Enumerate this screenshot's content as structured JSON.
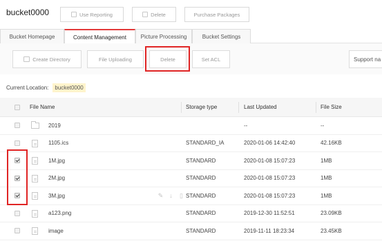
{
  "header": {
    "bucket_name": "bucket0000",
    "buttons": {
      "use_reporting": "Use Reporting",
      "delete": "Delete",
      "purchase_packages": "Purchase Packages"
    }
  },
  "tabs": {
    "bucket_homepage": "Bucket Homepage",
    "content_management": "Content Management",
    "picture_processing": "Picture Processing",
    "bucket_settings": "Bucket Settings",
    "active": "Content Management"
  },
  "toolbar": {
    "create_directory": "Create Directory",
    "file_uploading": "File Uploading",
    "delete": "Delete",
    "set_acl": "Set ACL",
    "search_placeholder": "Support na"
  },
  "location": {
    "label": "Current Location:",
    "value": "bucket0000"
  },
  "table": {
    "columns": {
      "file_name": "File Name",
      "storage_type": "Storage type",
      "last_updated": "Last Updated",
      "file_size": "File Size"
    },
    "rows": [
      {
        "name": "2019",
        "type": "folder",
        "storage": "",
        "updated": "--",
        "size": "--",
        "checked": false
      },
      {
        "name": "1105.ics",
        "type": "file",
        "storage": "STANDARD_IA",
        "updated": "2020-01-06 14:42:40",
        "size": "42.16KB",
        "checked": false
      },
      {
        "name": "1M.jpg",
        "type": "file",
        "storage": "STANDARD",
        "updated": "2020-01-08 15:07:23",
        "size": "1MB",
        "checked": true
      },
      {
        "name": "2M.jpg",
        "type": "file",
        "storage": "STANDARD",
        "updated": "2020-01-08 15:07:23",
        "size": "1MB",
        "checked": true
      },
      {
        "name": "3M.jpg",
        "type": "file",
        "storage": "STANDARD",
        "updated": "2020-01-08 15:07:23",
        "size": "1MB",
        "checked": true
      },
      {
        "name": "a123.png",
        "type": "file",
        "storage": "STANDARD",
        "updated": "2019-12-30 11:52:51",
        "size": "23.09KB",
        "checked": false
      },
      {
        "name": "image",
        "type": "file",
        "storage": "STANDARD",
        "updated": "2019-11-11 18:23:34",
        "size": "23.45KB",
        "checked": false
      }
    ]
  },
  "colors": {
    "accent": "#e23a3a",
    "highlight_box": "#e02424",
    "location_tag_bg": "#fff4cc"
  }
}
